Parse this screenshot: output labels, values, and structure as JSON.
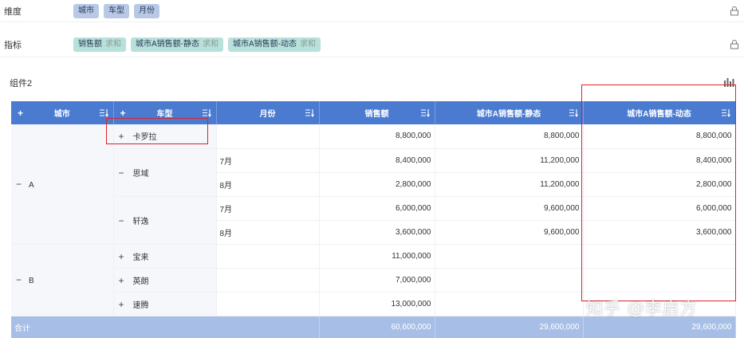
{
  "dimensions": {
    "label": "维度",
    "fields": [
      "城市",
      "车型",
      "月份"
    ]
  },
  "metrics": {
    "label": "指标",
    "fields": [
      {
        "name": "销售额",
        "agg": "求和"
      },
      {
        "name": "城市A销售额-静态",
        "agg": "求和"
      },
      {
        "name": "城市A销售额-动态",
        "agg": "求和"
      }
    ]
  },
  "widget": {
    "title": "组件2"
  },
  "table": {
    "plus": "+",
    "expanded": "−",
    "headers": [
      "城市",
      "车型",
      "月份",
      "销售额",
      "城市A销售额-静态",
      "城市A销售额-动态"
    ],
    "rows": [
      {
        "city": "A",
        "model": "卡罗拉",
        "month": "",
        "sales": "8,800,000",
        "static": "8,800,000",
        "dynamic": "8,800,000"
      },
      {
        "city": "",
        "model": "思域",
        "month": "7月",
        "sales": "8,400,000",
        "static": "11,200,000",
        "dynamic": "8,400,000"
      },
      {
        "city": "",
        "model": "",
        "month": "8月",
        "sales": "2,800,000",
        "static": "11,200,000",
        "dynamic": "2,800,000"
      },
      {
        "city": "",
        "model": "轩逸",
        "month": "7月",
        "sales": "6,000,000",
        "static": "9,600,000",
        "dynamic": "6,000,000"
      },
      {
        "city": "",
        "model": "",
        "month": "8月",
        "sales": "3,600,000",
        "static": "9,600,000",
        "dynamic": "3,600,000"
      },
      {
        "city": "B",
        "model": "宝来",
        "month": "",
        "sales": "11,000,000",
        "static": "",
        "dynamic": ""
      },
      {
        "city": "",
        "model": "英朗",
        "month": "",
        "sales": "7,000,000",
        "static": "",
        "dynamic": ""
      },
      {
        "city": "",
        "model": "速腾",
        "month": "",
        "sales": "13,000,000",
        "static": "",
        "dynamic": ""
      }
    ],
    "total": {
      "label": "合计",
      "sales": "60,600,000",
      "static": "29,600,000",
      "dynamic": "29,600,000"
    }
  },
  "watermark": "知乎 @李启方",
  "colors": {
    "header_blue": "#4a7bd0",
    "total_row": "#a7bfe6",
    "dim_pill": "#b8c9e6",
    "metric_pill": "#b7e1da",
    "highlight_red": "#d6252b"
  }
}
